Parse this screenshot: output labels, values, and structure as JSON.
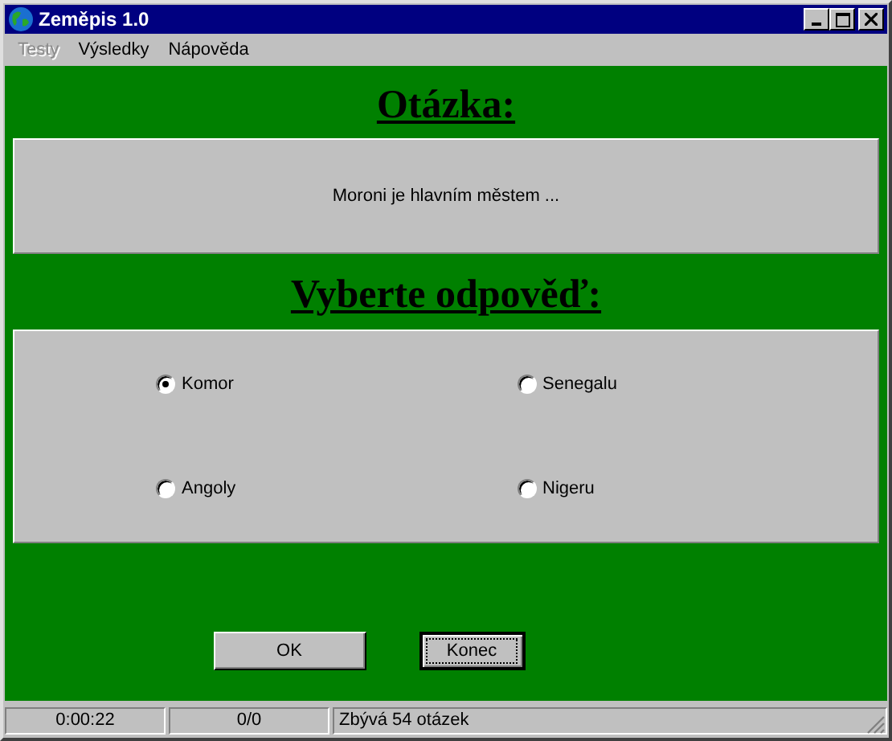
{
  "window": {
    "title": "Zeměpis 1.0"
  },
  "menu": [
    {
      "label": "Testy",
      "disabled": true
    },
    {
      "label": "Výsledky",
      "disabled": false
    },
    {
      "label": "Nápověda",
      "disabled": false
    }
  ],
  "question_heading": "Otázka:",
  "question": "Moroni je hlavním městem ...",
  "answers_heading": "Vyberte odpověď:",
  "answers": [
    {
      "label": "Komor",
      "selected": true
    },
    {
      "label": "Senegalu",
      "selected": false
    },
    {
      "label": "Angoly",
      "selected": false
    },
    {
      "label": "Nigeru",
      "selected": false
    }
  ],
  "buttons": [
    {
      "label": "OK",
      "focused": false
    },
    {
      "label": "Konec",
      "focused": true
    }
  ],
  "status_bar": [
    "0:00:22",
    "0/0",
    "Zbývá 54 otázek"
  ]
}
